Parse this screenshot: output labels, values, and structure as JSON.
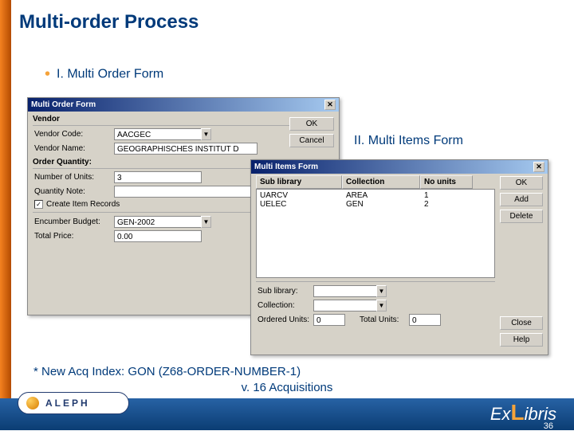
{
  "slide": {
    "title": "Multi-order Process",
    "bullet1": "I. Multi Order Form",
    "bullet2": "II. Multi Items Form",
    "asterisk": "* New Acq Index: GON (Z68-ORDER-NUMBER-1)",
    "footer": "v. 16 Acquisitions",
    "page_number": "36",
    "aleph": "ALEPH",
    "exlibris_prefix": "Ex",
    "exlibris_l": "L",
    "exlibris_suffix": "ibris"
  },
  "multi_order_form": {
    "title": "Multi Order Form",
    "buttons": {
      "ok": "OK",
      "cancel": "Cancel"
    },
    "vendor": {
      "heading": "Vendor",
      "code_label": "Vendor Code:",
      "code_value": "AACGEC",
      "name_label": "Vendor Name:",
      "name_value": "GEOGRAPHISCHES INSTITUT D"
    },
    "quantity": {
      "heading": "Order Quantity:",
      "units_label": "Number of Units:",
      "units_value": "3",
      "note_label": "Quantity Note:",
      "note_value": "",
      "create_items_label": "Create Item Records",
      "create_items_checked": true
    },
    "budget": {
      "encumber_label": "Encumber Budget:",
      "encumber_value": "GEN-2002",
      "total_label": "Total Price:",
      "total_value": "0.00"
    }
  },
  "multi_items_form": {
    "title": "Multi Items Form",
    "columns": {
      "sublibrary": "Sub library",
      "collection": "Collection",
      "units": "No units"
    },
    "rows": [
      {
        "sublibrary": "UARCV",
        "collection": "AREA",
        "units": "1"
      },
      {
        "sublibrary": "UELEC",
        "collection": "GEN",
        "units": "2"
      }
    ],
    "buttons": {
      "ok": "OK",
      "add": "Add",
      "delete": "Delete",
      "close": "Close",
      "help": "Help"
    },
    "inputs": {
      "sublibrary_label": "Sub library:",
      "sublibrary_value": "",
      "collection_label": "Collection:",
      "collection_value": "",
      "ordered_label": "Ordered Units:",
      "ordered_value": "0",
      "total_label": "Total Units:",
      "total_value": "0"
    }
  }
}
